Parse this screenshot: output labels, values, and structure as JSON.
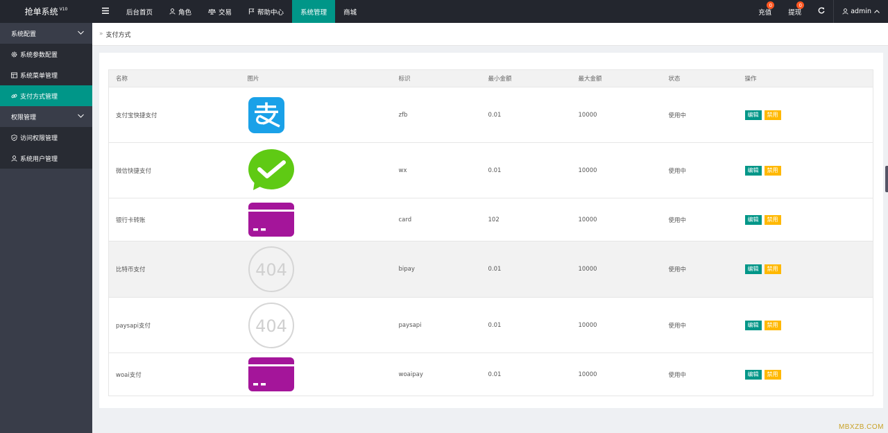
{
  "app": {
    "title": "抢单系统",
    "version": "V10"
  },
  "topnav": {
    "items": [
      {
        "label": "后台首页",
        "icon": ""
      },
      {
        "label": "角色",
        "icon": "user-icon"
      },
      {
        "label": "交易",
        "icon": "scale-icon"
      },
      {
        "label": "帮助中心",
        "icon": "flag-icon"
      },
      {
        "label": "系统管理",
        "icon": "",
        "active": true
      },
      {
        "label": "商城",
        "icon": ""
      }
    ],
    "recharge": {
      "label": "充值",
      "badge": "0"
    },
    "withdraw": {
      "label": "提现",
      "badge": "0"
    },
    "user": {
      "label": "admin"
    }
  },
  "sidebar": {
    "group1": {
      "label": "系统配置"
    },
    "items1": [
      {
        "label": "系统参数配置",
        "icon": "gear-icon"
      },
      {
        "label": "系统菜单管理",
        "icon": "table-icon"
      },
      {
        "label": "支付方式管理",
        "icon": "link-icon",
        "active": true
      }
    ],
    "group2": {
      "label": "权限管理"
    },
    "items2": [
      {
        "label": "访问权限管理",
        "icon": "shield-icon"
      },
      {
        "label": "系统用户管理",
        "icon": "user-icon"
      }
    ]
  },
  "breadcrumb": {
    "current": "支付方式"
  },
  "table": {
    "headers": [
      "名称",
      "图片",
      "标识",
      "最小金额",
      "最大金额",
      "状态",
      "操作"
    ],
    "edit_label": "编辑",
    "disable_label": "禁用",
    "rows": [
      {
        "name": "支付宝快捷支付",
        "image": "alipay-logo",
        "code": "zfb",
        "min": "0.01",
        "max": "10000",
        "status": "使用中"
      },
      {
        "name": "微信快捷支付",
        "image": "wechat-logo",
        "code": "wx",
        "min": "0.01",
        "max": "10000",
        "status": "使用中"
      },
      {
        "name": "银行卡转账",
        "image": "bank-card-icon",
        "code": "card",
        "min": "102",
        "max": "10000",
        "status": "使用中"
      },
      {
        "name": "比特币支付",
        "image": "image-404",
        "code": "bipay",
        "min": "0.01",
        "max": "10000",
        "status": "使用中"
      },
      {
        "name": "paysapi支付",
        "image": "image-404",
        "code": "paysapi",
        "min": "0.01",
        "max": "10000",
        "status": "使用中"
      },
      {
        "name": "woai支付",
        "image": "bank-card-icon",
        "code": "woaipay",
        "min": "0.01",
        "max": "10000",
        "status": "使用中"
      }
    ],
    "not_found_text": "404"
  },
  "watermark": "MBXZB.COM",
  "colors": {
    "accent": "#009688",
    "warn": "#ffb800",
    "status": "#5fb878",
    "sidebar": "#393d49"
  }
}
